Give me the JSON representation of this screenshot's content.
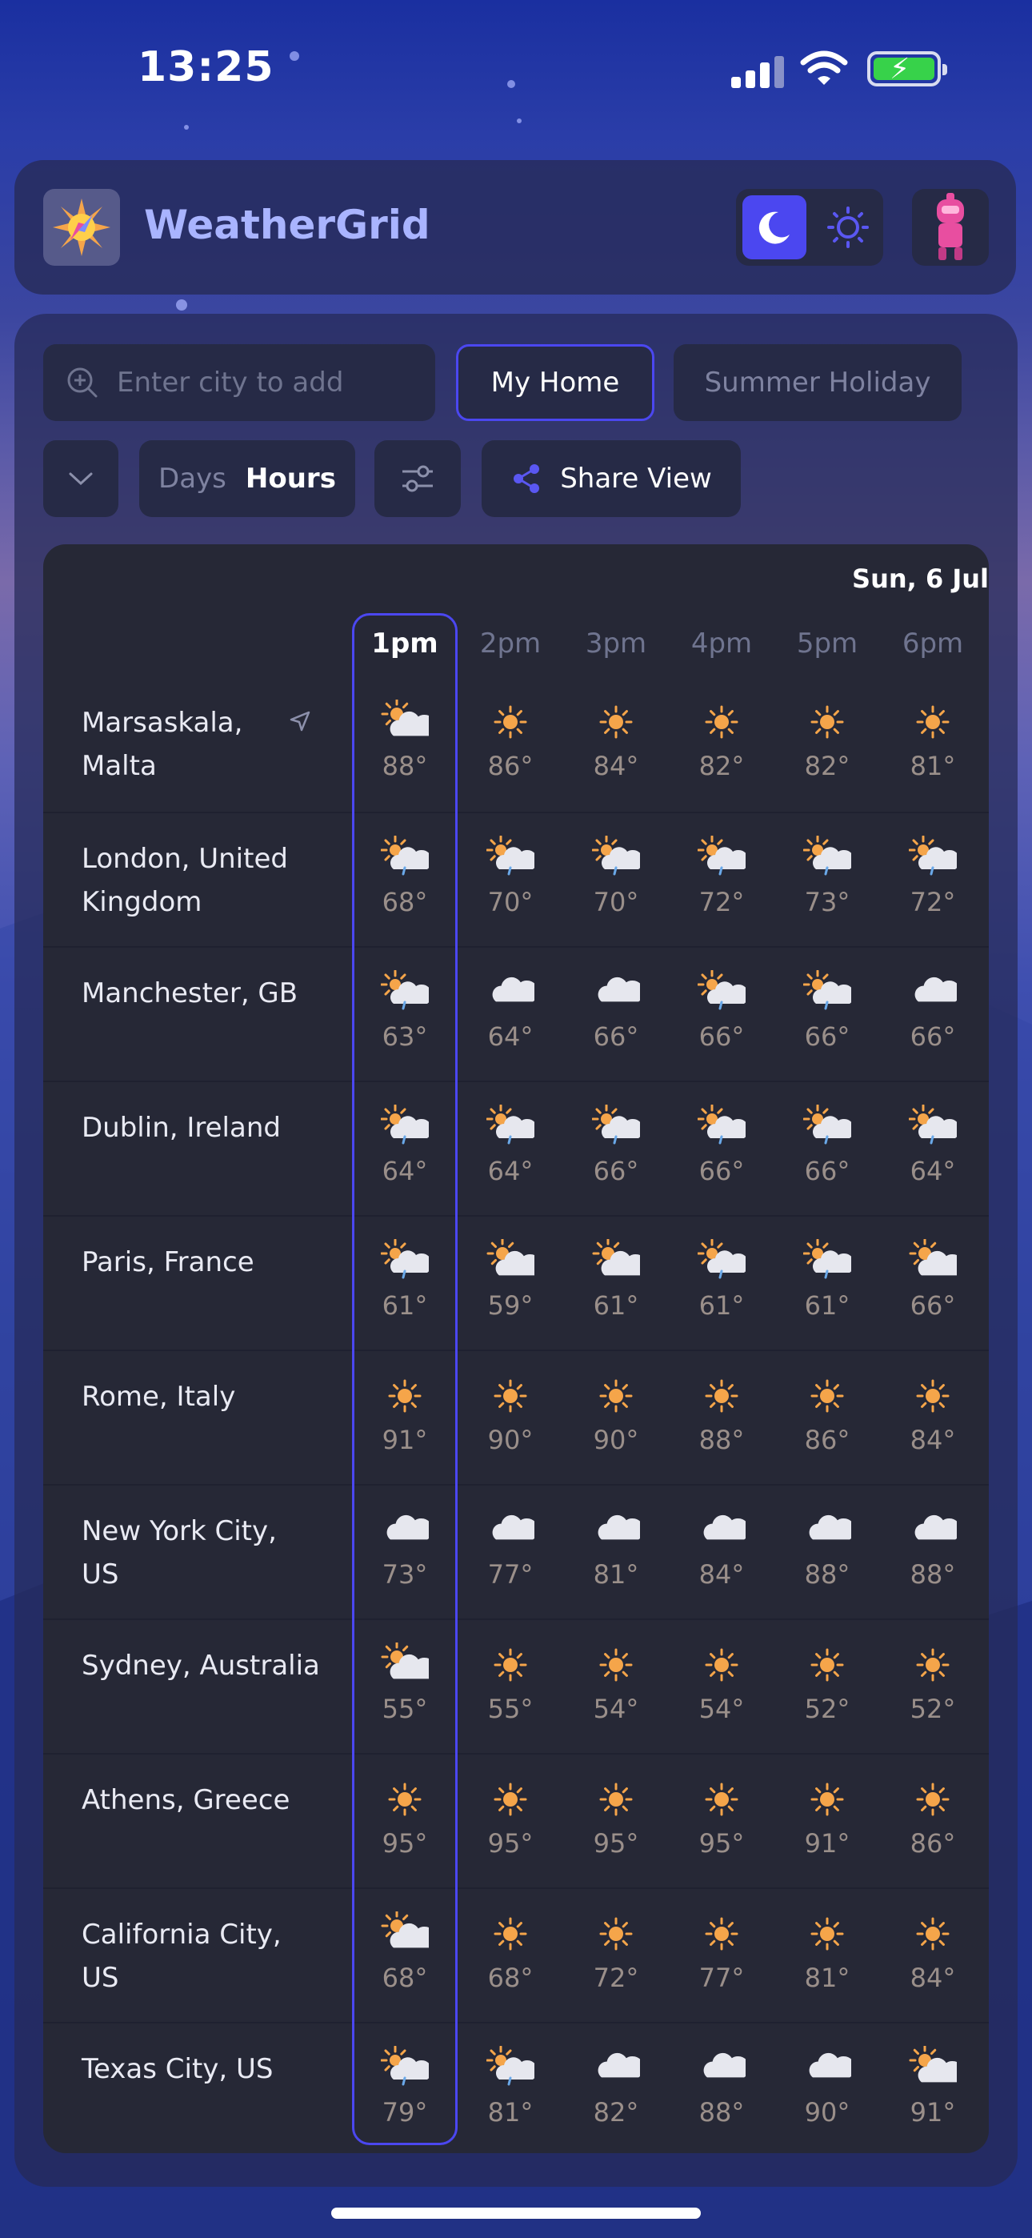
{
  "status": {
    "time": "13:25"
  },
  "app": {
    "name": "WeatherGrid"
  },
  "search": {
    "placeholder": "Enter city to add"
  },
  "views": {
    "active": "My Home",
    "inactive": "Summer Holiday"
  },
  "controls": {
    "days": "Days",
    "hours": "Hours",
    "share": "Share View"
  },
  "date": "Sun, 6 Jul",
  "hours": [
    "1pm",
    "2pm",
    "3pm",
    "4pm",
    "5pm",
    "6pm"
  ],
  "cities": [
    {
      "name": "Marsaskala, Malta",
      "icons": [
        "sun-cloud",
        "sun",
        "sun",
        "sun",
        "sun",
        "sun"
      ],
      "temps": [
        "88°",
        "86°",
        "84°",
        "82°",
        "82°",
        "81°"
      ]
    },
    {
      "name": "London, United Kingdom",
      "icons": [
        "sun-rain",
        "sun-rain",
        "sun-rain",
        "sun-rain",
        "sun-rain",
        "sun-rain"
      ],
      "temps": [
        "68°",
        "70°",
        "70°",
        "72°",
        "73°",
        "72°"
      ]
    },
    {
      "name": "Manchester, GB",
      "icons": [
        "sun-rain",
        "cloud",
        "cloud",
        "sun-rain",
        "sun-rain",
        "cloud"
      ],
      "temps": [
        "63°",
        "64°",
        "66°",
        "66°",
        "66°",
        "66°"
      ]
    },
    {
      "name": "Dublin, Ireland",
      "icons": [
        "sun-rain",
        "sun-rain",
        "sun-rain",
        "sun-rain",
        "sun-rain",
        "sun-rain"
      ],
      "temps": [
        "64°",
        "64°",
        "66°",
        "66°",
        "66°",
        "64°"
      ]
    },
    {
      "name": "Paris, France",
      "icons": [
        "sun-rain",
        "sun-cloud",
        "sun-cloud",
        "sun-rain",
        "sun-rain",
        "sun-cloud"
      ],
      "temps": [
        "61°",
        "59°",
        "61°",
        "61°",
        "61°",
        "66°"
      ]
    },
    {
      "name": "Rome, Italy",
      "icons": [
        "sun",
        "sun",
        "sun",
        "sun",
        "sun",
        "sun"
      ],
      "temps": [
        "91°",
        "90°",
        "90°",
        "88°",
        "86°",
        "84°"
      ]
    },
    {
      "name": "New York City, US",
      "icons": [
        "cloud",
        "cloud",
        "cloud",
        "cloud",
        "cloud",
        "cloud"
      ],
      "temps": [
        "73°",
        "77°",
        "81°",
        "84°",
        "88°",
        "88°"
      ]
    },
    {
      "name": "Sydney, Australia",
      "icons": [
        "sun-cloud",
        "sun",
        "sun",
        "sun",
        "sun",
        "sun"
      ],
      "temps": [
        "55°",
        "55°",
        "54°",
        "54°",
        "52°",
        "52°"
      ]
    },
    {
      "name": "Athens, Greece",
      "icons": [
        "sun",
        "sun",
        "sun",
        "sun",
        "sun",
        "sun"
      ],
      "temps": [
        "95°",
        "95°",
        "95°",
        "95°",
        "91°",
        "86°"
      ]
    },
    {
      "name": "California City, US",
      "icons": [
        "sun-cloud",
        "sun",
        "sun",
        "sun",
        "sun",
        "sun"
      ],
      "temps": [
        "68°",
        "68°",
        "72°",
        "77°",
        "81°",
        "84°"
      ]
    },
    {
      "name": "Texas City, US",
      "icons": [
        "sun-rain",
        "sun-rain",
        "cloud",
        "cloud",
        "cloud",
        "sun-cloud"
      ],
      "temps": [
        "79°",
        "81°",
        "82°",
        "88°",
        "90°",
        "91°"
      ]
    }
  ],
  "colors": {
    "accent": "#4b47f0",
    "sun": "#f5a54a",
    "cloud": "#e6e7ee",
    "rain": "#6aa8e8",
    "temp": "#9a8f8a",
    "brand": "#a9b4ff"
  }
}
